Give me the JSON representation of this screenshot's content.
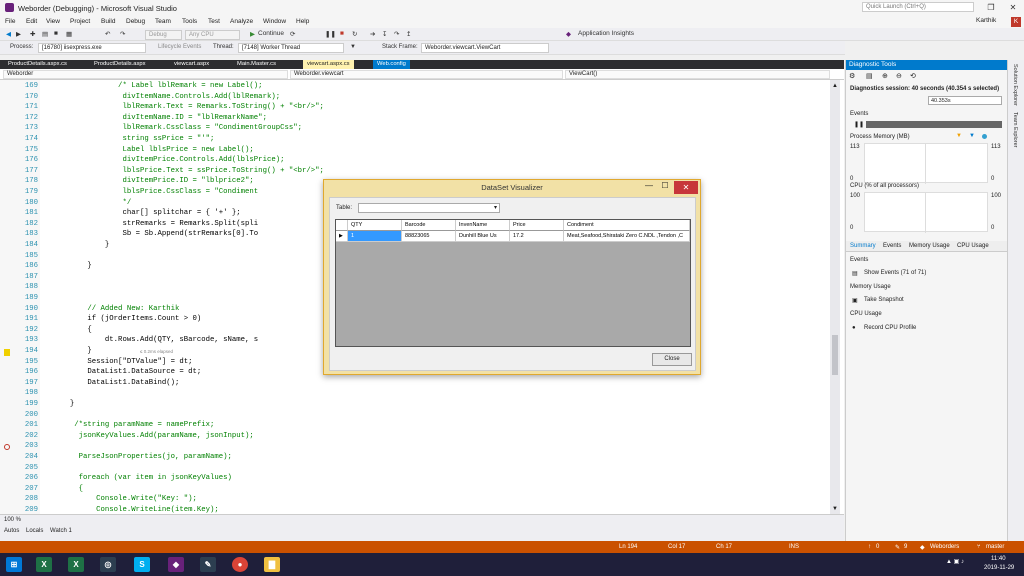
{
  "window": {
    "title": "Weborder (Debugging) - Microsoft Visual Studio",
    "minimize": "—",
    "restore": "❐",
    "close": "✕"
  },
  "menu": [
    "File",
    "Edit",
    "View",
    "Project",
    "Build",
    "Debug",
    "Team",
    "Tools",
    "Test",
    "Analyze",
    "Window",
    "Help"
  ],
  "quick_launch": {
    "placeholder": "Quick Launch (Ctrl+Q)"
  },
  "user": {
    "name": "Karthik",
    "initial": "K"
  },
  "toolbar": {
    "config": "Debug",
    "platform": "Any CPU",
    "continue_label": "Continue",
    "app_insights": "Application Insights"
  },
  "toolbar2": {
    "process_label": "Process:",
    "process_value": "[16780] iisexpress.exe",
    "lifecycle_label": "Lifecycle Events",
    "thread_label": "Thread:",
    "thread_value": "[7148] Worker Thread",
    "stack_label": "Stack Frame:",
    "stack_value": "Weborder.viewcart.ViewCart"
  },
  "tabs": [
    "ProductDetails.aspx.cs",
    "ProductDetails.aspx",
    "viewcart.aspx",
    "Main.Master.cs",
    "viewcart.aspx.cs",
    "Web.config"
  ],
  "navbar": {
    "project": "Weborder",
    "class": "Weborder.viewcart",
    "method": "ViewCart()"
  },
  "code_lines": [
    {
      "n": "169",
      "t": "                /* Label lblRemark = new Label();"
    },
    {
      "n": "170",
      "t": "                 divItemName.Controls.Add(lblRemark);"
    },
    {
      "n": "171",
      "t": "                 lblRemark.Text = Remarks.ToString() + \"<br/>\";"
    },
    {
      "n": "172",
      "t": "                 divItemName.ID = \"lblRemarkName\";"
    },
    {
      "n": "173",
      "t": "                 lblRemark.CssClass = \"CondimentGroupCss\";"
    },
    {
      "n": "174",
      "t": "                 string ssPrice = \"'\";"
    },
    {
      "n": "175",
      "t": "                 Label lblsPrice = new Label();"
    },
    {
      "n": "176",
      "t": "                 divItemPrice.Controls.Add(lblsPrice);"
    },
    {
      "n": "177",
      "t": "                 lblsPrice.Text = ssPrice.ToString() + \"<br/>\";"
    },
    {
      "n": "178",
      "t": "                 divItemPrice.ID = \"lblprice2\";"
    },
    {
      "n": "179",
      "t": "                 lblsPrice.CssClass = \"Condiment"
    },
    {
      "n": "180",
      "t": "                 */"
    },
    {
      "n": "181",
      "t": "                 char[] splitchar = { '+' };"
    },
    {
      "n": "182",
      "t": "                 strRemarks = Remarks.Split(spli"
    },
    {
      "n": "183",
      "t": "                 Sb = Sb.Append(strRemarks[0].To"
    },
    {
      "n": "184",
      "t": "             }"
    },
    {
      "n": "185",
      "t": ""
    },
    {
      "n": "186",
      "t": "         }"
    },
    {
      "n": "187",
      "t": ""
    },
    {
      "n": "188",
      "t": ""
    },
    {
      "n": "189",
      "t": ""
    },
    {
      "n": "190",
      "t": "         // Added New: Karthik"
    },
    {
      "n": "191",
      "t": "         if (jOrderItems.Count > 0)"
    },
    {
      "n": "192",
      "t": "         {"
    },
    {
      "n": "193",
      "t": "             dt.Rows.Add(QTY, sBarcode, sName, s"
    },
    {
      "n": "194",
      "t": "         }"
    },
    {
      "n": "195",
      "t": "         Session[\"DTValue\"] = dt;"
    },
    {
      "n": "196",
      "t": "         DataList1.DataSource = dt;"
    },
    {
      "n": "197",
      "t": "         DataList1.DataBind();"
    },
    {
      "n": "198",
      "t": ""
    },
    {
      "n": "199",
      "t": "     }"
    },
    {
      "n": "200",
      "t": ""
    },
    {
      "n": "201",
      "t": "      /*string paramName = namePrefix;"
    },
    {
      "n": "202",
      "t": "       jsonKeyValues.Add(paramName, jsonInput);"
    },
    {
      "n": "203",
      "t": ""
    },
    {
      "n": "204",
      "t": "       ParseJsonProperties(jo, paramName);"
    },
    {
      "n": "205",
      "t": ""
    },
    {
      "n": "206",
      "t": "       foreach (var item in jsonKeyValues)"
    },
    {
      "n": "207",
      "t": "       {"
    },
    {
      "n": "208",
      "t": "           Console.Write(\"Key: \");"
    },
    {
      "n": "209",
      "t": "           Console.WriteLine(item.Key);"
    }
  ],
  "elapsed_hint": "≤ 0.2ms elapsed",
  "zoom": "100 %",
  "bottom_tabs": [
    "Autos",
    "Locals",
    "Watch 1"
  ],
  "status": {
    "ln": "Ln 194",
    "col": "Col 17",
    "ch": "Ch 17",
    "ins": "INS",
    "up": "0",
    "pencil": "9",
    "repo": "Weborders",
    "branch": "master"
  },
  "diag": {
    "title": "Diagnostic Tools",
    "session": "Diagnostics session: 40 seconds (40.354 s selected)",
    "time_mark": "40.353s",
    "events_label": "Events",
    "memory_label": "Process Memory (MB)",
    "mem_max": "113",
    "mem_min": "0",
    "cpu_label": "CPU (% of all processors)",
    "cpu_max": "100",
    "cpu_min": "0",
    "tabs": [
      "Summary",
      "Events",
      "Memory Usage",
      "CPU Usage"
    ],
    "events_section": "Events",
    "show_events": "Show Events (71 of 71)",
    "memory_section": "Memory Usage",
    "take_snapshot": "Take Snapshot",
    "cpu_section": "CPU Usage",
    "record_cpu": "Record CPU Profile"
  },
  "side_tabs": [
    "Solution Explorer",
    "Team Explorer"
  ],
  "dialog": {
    "title": "DataSet Visualizer",
    "table_label": "Table:",
    "columns": [
      "QTY",
      "Barcode",
      "InvenName",
      "Price",
      "Condiment"
    ],
    "row": [
      "1",
      "88823065",
      "Dunhill Blue Us",
      "17.2",
      "Meat,Seafood,Shirataki Zero C.NDL ,Tendon ,C"
    ],
    "close_label": "Close"
  },
  "taskbar": {
    "time": "11:40",
    "date": "2019-11-29"
  },
  "colors": {
    "accent": "#007acc",
    "status": "#ca5100",
    "taskbar": "#1f1f3a",
    "dialog": "#f2e1a6"
  }
}
